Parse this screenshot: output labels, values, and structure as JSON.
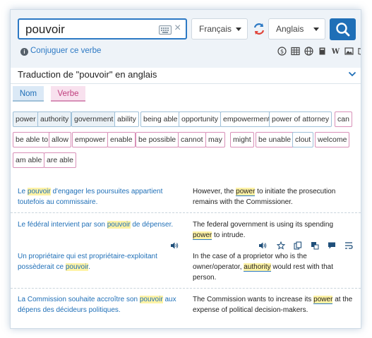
{
  "search": {
    "value": "pouvoir"
  },
  "source_lang": "Français",
  "target_lang": "Anglais",
  "conjugate_link": "Conjuguer ce verbe",
  "translation_title": "Traduction de \"pouvoir\" en anglais",
  "pos_tabs": [
    {
      "label": "Nom"
    },
    {
      "label": "Verbe"
    }
  ],
  "chips": [
    {
      "label": "power"
    },
    {
      "label": "authority"
    },
    {
      "label": "government"
    },
    {
      "label": "ability"
    },
    {
      "label": "being able"
    },
    {
      "label": "opportunity"
    },
    {
      "label": "empowerment"
    },
    {
      "label": "power of attorney"
    },
    {
      "label": "can"
    },
    {
      "label": "be able to"
    },
    {
      "label": "allow"
    },
    {
      "label": "empower"
    },
    {
      "label": "enable"
    },
    {
      "label": "be possible"
    },
    {
      "label": "cannot"
    },
    {
      "label": "may"
    },
    {
      "label": "might"
    },
    {
      "label": "be unable"
    },
    {
      "label": "clout"
    },
    {
      "label": "welcome"
    },
    {
      "label": "am able"
    },
    {
      "label": "are able"
    }
  ],
  "examples": [
    {
      "src": [
        "Le ",
        "pouvoir",
        " d'engager les poursuites appartient toutefois au commissaire."
      ],
      "tgt": [
        "However, the ",
        "power",
        " to initiate the prosecution remains with the Commissioner."
      ]
    },
    {
      "src": [
        "Le fédéral intervient par son ",
        "pouvoir",
        " de dépenser."
      ],
      "tgt": [
        "The federal government is using its spending ",
        "power",
        " to intrude."
      ]
    },
    {
      "src": [
        "Un propriétaire qui est propriétaire-exploitant possèderait ce ",
        "pouvoir",
        "."
      ],
      "tgt": [
        "In the case of a proprietor who is the owner/operator, ",
        "authority",
        " would rest with that person."
      ]
    },
    {
      "src": [
        "La Commission souhaite accroître son ",
        "pouvoir",
        " aux dépens des décideurs politiques."
      ],
      "tgt": [
        "The Commission wants to increase its ",
        "power",
        " at the expense of political decision-makers."
      ]
    }
  ],
  "colors": {
    "accent": "#1f6fb7",
    "highlight": "#fff3a6",
    "noun_tab": "#dbe9f6",
    "verb_tab": "#f8e1ee"
  }
}
